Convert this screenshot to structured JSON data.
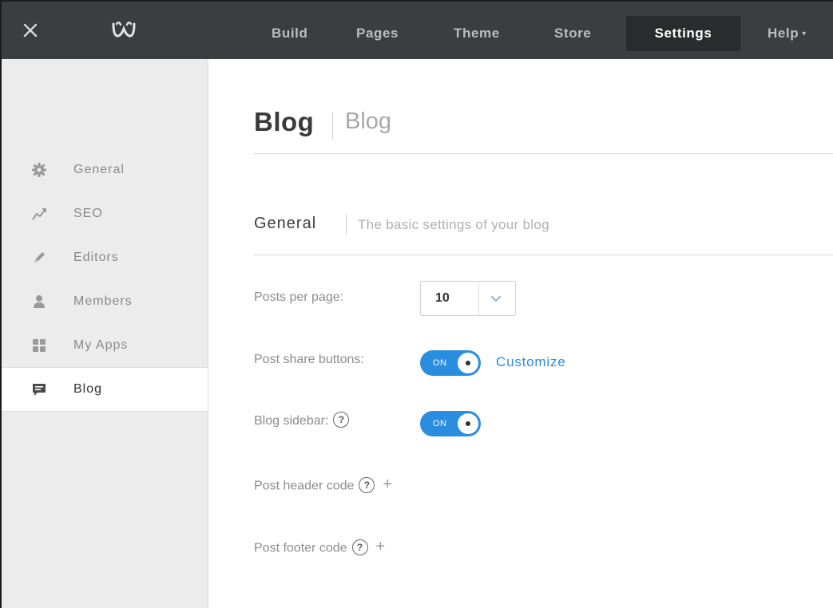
{
  "topbar": {
    "close_icon": "close-icon",
    "logo_icon": "weebly-logo-icon",
    "nav": [
      {
        "label": "Build"
      },
      {
        "label": "Pages"
      },
      {
        "label": "Theme"
      },
      {
        "label": "Store"
      },
      {
        "label": "Settings",
        "active": true
      },
      {
        "label": "Help"
      }
    ]
  },
  "sidebar": {
    "items": [
      {
        "label": "General",
        "icon": "gear-icon"
      },
      {
        "label": "SEO",
        "icon": "trend-line-icon"
      },
      {
        "label": "Editors",
        "icon": "pencil-icon"
      },
      {
        "label": "Members",
        "icon": "person-icon"
      },
      {
        "label": "My Apps",
        "icon": "apps-grid-icon"
      },
      {
        "label": "Blog",
        "icon": "blog-comment-icon",
        "active": true
      }
    ]
  },
  "main": {
    "title": "Blog",
    "subtitle": "Blog",
    "section": {
      "title": "General",
      "description": "The basic settings of your blog"
    },
    "posts_per_page": {
      "label": "Posts per page:",
      "value": "10"
    },
    "post_share_buttons": {
      "label": "Post share buttons:",
      "toggle": "ON",
      "link": "Customize"
    },
    "blog_sidebar": {
      "label": "Blog sidebar:",
      "toggle": "ON"
    },
    "post_header_code": {
      "label": "Post header code"
    },
    "post_footer_code": {
      "label": "Post footer code"
    }
  },
  "colors": {
    "topbar": "#3c3d3f",
    "accent": "#2a8de0",
    "sidebar": "#ececec"
  }
}
